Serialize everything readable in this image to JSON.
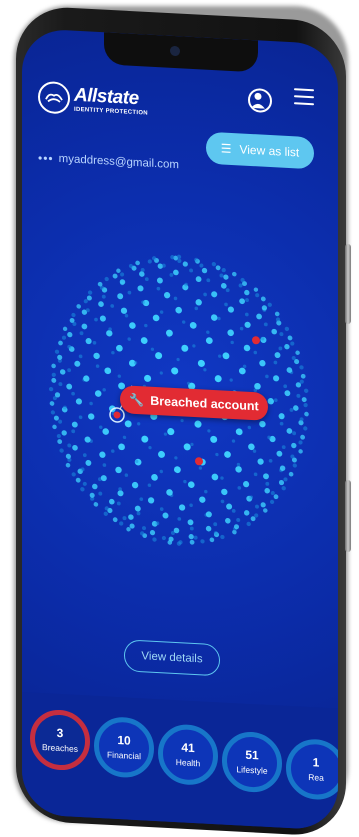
{
  "brand": {
    "name": "Allstate",
    "subtitle": "IDENTITY PROTECTION"
  },
  "header": {
    "profile_icon": "user-icon",
    "menu_icon": "hamburger-menu-icon"
  },
  "account": {
    "email": "myaddress@gmail.com",
    "dots": "•••"
  },
  "view_list_button": {
    "label": "View as list",
    "icon": "list-icon"
  },
  "breach_label": {
    "text": "Breached account",
    "icon": "wrench-icon"
  },
  "details_button": {
    "label": "View details"
  },
  "categories": [
    {
      "count": "3",
      "label": "Breaches"
    },
    {
      "count": "10",
      "label": "Financial"
    },
    {
      "count": "41",
      "label": "Health"
    },
    {
      "count": "51",
      "label": "Lifestyle"
    },
    {
      "count": "1",
      "label": "Rea"
    }
  ],
  "colors": {
    "screen_bg": "#0b2ba7",
    "accent_cyan": "#5ec7f0",
    "breach_red": "#e22b33"
  }
}
